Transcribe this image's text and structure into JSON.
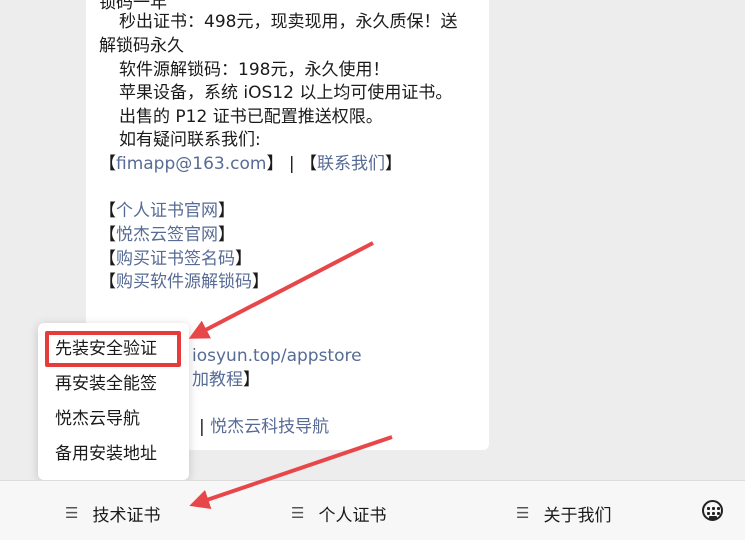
{
  "message": {
    "line_top": "锁码一年",
    "line1": "秒出证书：498元，现卖现用，永久质保！送",
    "line2": "解锁码永久",
    "line3": "软件源解锁码：198元，永久使用！",
    "line4": "苹果设备，系统 iOS12 以上均可使用证书。",
    "line5": "出售的 P12 证书已配置推送权限。",
    "line6": "如有疑问联系我们:",
    "bracket_open": "【",
    "bracket_close": "】",
    "separator": " | ",
    "email_link": "fimapp@163.com",
    "contact_link": "联系我们",
    "link_personal_cert": "个人证书官网",
    "link_yuejie_sign": "悦杰云签官网",
    "link_buy_cert": "购买证书签名码",
    "link_buy_unlock": "购买软件源解锁码",
    "link_appstore_partial": "iosyun.top/appstore",
    "link_tutorial_partial": "加教程",
    "separator2": "|",
    "link_nav_partial": "悦杰云科技导航"
  },
  "popup_menu": {
    "items": [
      "先装安全验证",
      "再安装全能签",
      "悦杰云导航",
      "备用安装地址"
    ]
  },
  "bottom_bar": {
    "tabs": [
      "技术证书",
      "个人证书",
      "关于我们"
    ],
    "hamburger": "☰"
  },
  "colors": {
    "link": "#576b95",
    "highlight": "#e53b3b",
    "arrow": "#e8474a"
  },
  "icons": {
    "menu": "hamburger-icon",
    "keyboard": "keyboard-icon"
  }
}
